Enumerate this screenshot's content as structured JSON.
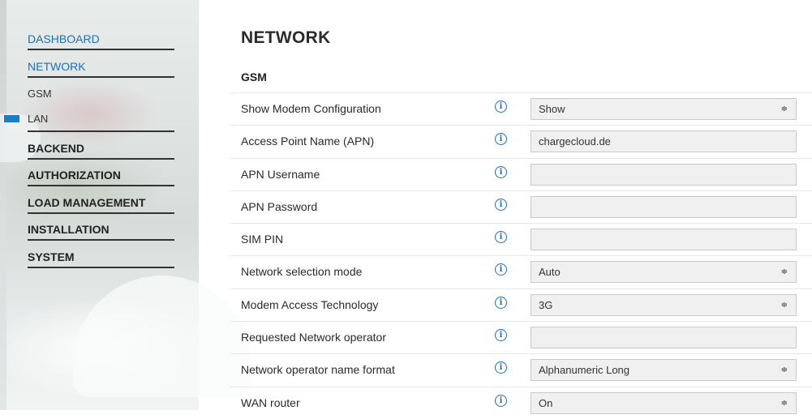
{
  "sidebar": {
    "items": [
      {
        "label": "DASHBOARD",
        "name": "nav-dashboard"
      },
      {
        "label": "NETWORK",
        "name": "nav-network"
      },
      {
        "label": "GSM",
        "name": "nav-sub-gsm"
      },
      {
        "label": "LAN",
        "name": "nav-sub-lan"
      },
      {
        "label": "BACKEND",
        "name": "nav-backend"
      },
      {
        "label": "AUTHORIZATION",
        "name": "nav-authorization"
      },
      {
        "label": "LOAD MANAGEMENT",
        "name": "nav-load-management"
      },
      {
        "label": "INSTALLATION",
        "name": "nav-installation"
      },
      {
        "label": "SYSTEM",
        "name": "nav-system"
      }
    ]
  },
  "main": {
    "title": "NETWORK",
    "section": "GSM",
    "info_icon": "info-icon",
    "select_arrow": "≑",
    "rows": [
      {
        "label": "Show Modem Configuration",
        "value": "Show",
        "type": "select"
      },
      {
        "label": "Access Point Name (APN)",
        "value": "chargecloud.de",
        "type": "input"
      },
      {
        "label": "APN Username",
        "value": "",
        "type": "input"
      },
      {
        "label": "APN Password",
        "value": "",
        "type": "input"
      },
      {
        "label": "SIM PIN",
        "value": "",
        "type": "input"
      },
      {
        "label": "Network selection mode",
        "value": "Auto",
        "type": "select"
      },
      {
        "label": "Modem Access Technology",
        "value": "3G",
        "type": "select"
      },
      {
        "label": "Requested Network operator",
        "value": "",
        "type": "input"
      },
      {
        "label": "Network operator name format",
        "value": "Alphanumeric Long",
        "type": "select"
      },
      {
        "label": "WAN router",
        "value": "On",
        "type": "select"
      }
    ]
  },
  "colors": {
    "accent": "#1f6fb2",
    "indicator": "#1f7bc4",
    "field_bg": "#f0f0f0"
  }
}
